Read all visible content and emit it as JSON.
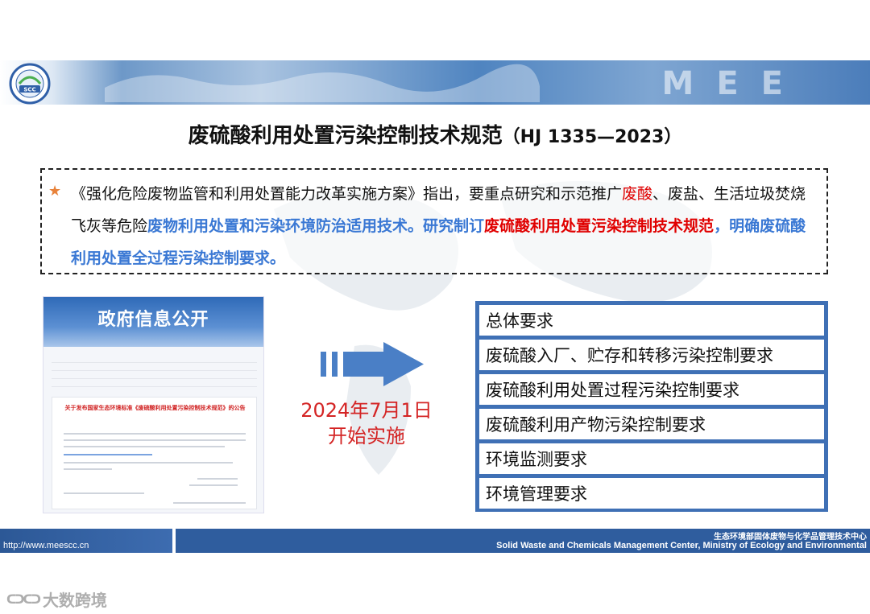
{
  "header": {
    "logo_text": "SCC",
    "banner_text": "MEE"
  },
  "title": {
    "main": "废硫酸利用处置污染控制技术规范",
    "code": "（HJ 1335—2023）"
  },
  "notice": {
    "star": "★",
    "seg1": "《强化危险废物监管和利用处置能力改革实施方案》指出，要重点研究和示范推广",
    "seg2": "废酸",
    "seg3": "、废盐、生活垃圾焚烧飞灰等危险",
    "seg4": "废物利用处置和污染环境防治适用技术。",
    "seg5": "研究制订",
    "seg6": "废硫酸利用处置污染控制技术规范",
    "seg7": "，明确废硫酸利用处置全过程污染控制要求。"
  },
  "document_image": {
    "header": "政府信息公开",
    "panel_title": "关于发布国家生态环境标准《废硫酸利用处置污染控制技术规范》的公告"
  },
  "effective": {
    "line1": "2024年7月1日",
    "line2": "开始实施"
  },
  "requirements": [
    "总体要求",
    "废硫酸入厂、贮存和转移污染控制要求",
    "废硫酸利用处置过程污染控制要求",
    "废硫酸利用产物污染控制要求",
    "环境监测要求",
    "环境管理要求"
  ],
  "footer": {
    "url": "http://www.meescc.cn",
    "center_cn": "生态环境部固体废物与化学品管理技术中心",
    "center_en": "Solid Waste and Chemicals Management Center, Ministry of Ecology and Environmental"
  },
  "watermark": {
    "icon": "ᑕᑐᑕᑐ",
    "text": "大数跨境"
  },
  "colors": {
    "accent_red": "#e00000",
    "accent_blue": "#3a78d4",
    "list_border": "#3f70b5",
    "footer_bg": "#2f5d9e",
    "date_red": "#d42424"
  }
}
